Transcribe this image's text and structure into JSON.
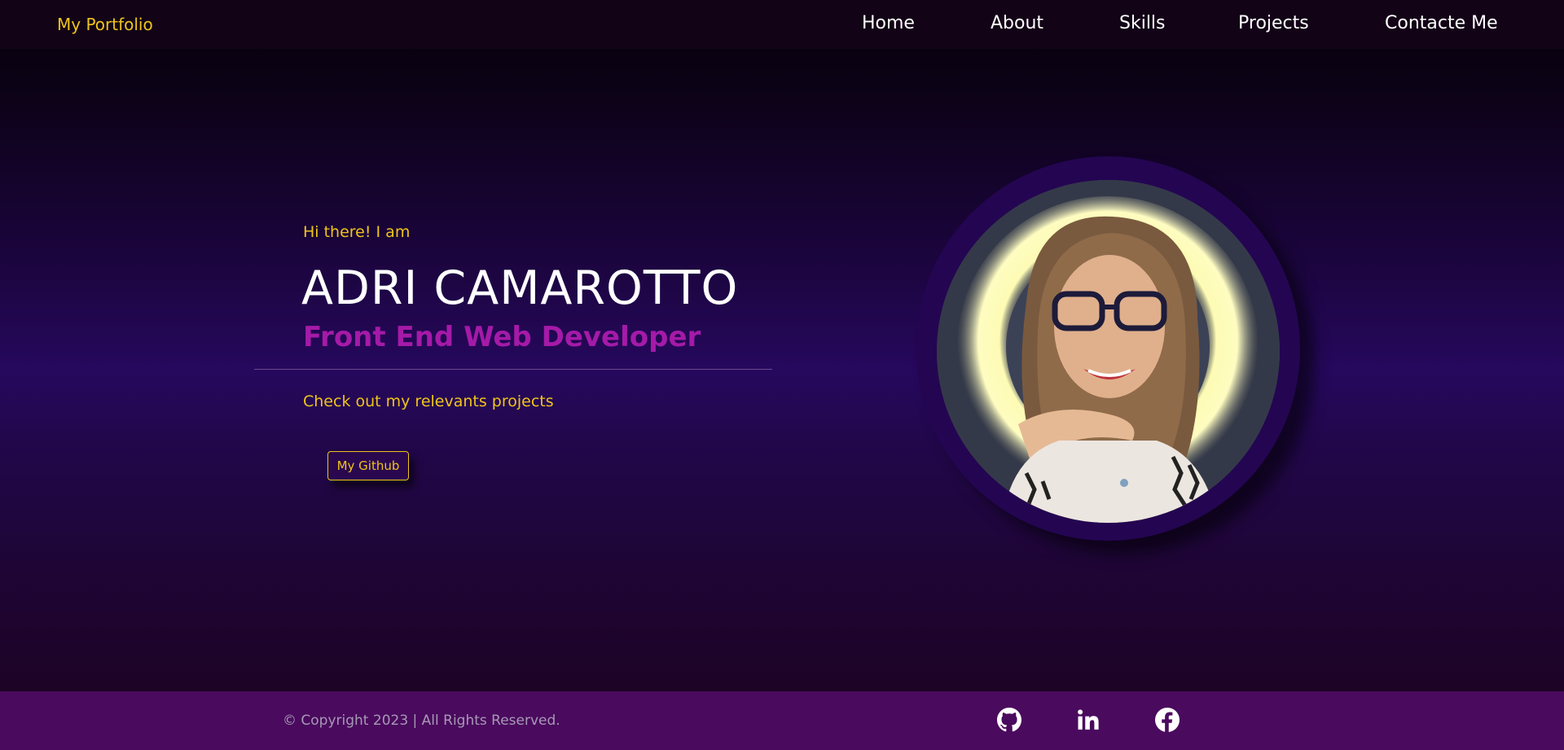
{
  "navbar": {
    "logo": "My Portfolio",
    "links": [
      "Home",
      "About",
      "Skills",
      "Projects",
      "Contacte Me"
    ]
  },
  "hero": {
    "greeting": "Hi there! I am",
    "name": "ADRI CAMAROTTO",
    "role": "Front End Web Developer",
    "cta_text": "Check out my relevants projects",
    "github_button": "My Github"
  },
  "photo": {
    "icon": "profile-photo"
  },
  "footer": {
    "copyright": "© Copyright 2023 | All Rights Reserved.",
    "social_icons": [
      "github-icon",
      "linkedin-icon",
      "facebook-icon"
    ]
  },
  "colors": {
    "accent": "#f0c419",
    "role": "#a51aa8",
    "navbar_bg": "#120416",
    "footer_bg": "#4a0a5e",
    "ring": "#240552"
  }
}
